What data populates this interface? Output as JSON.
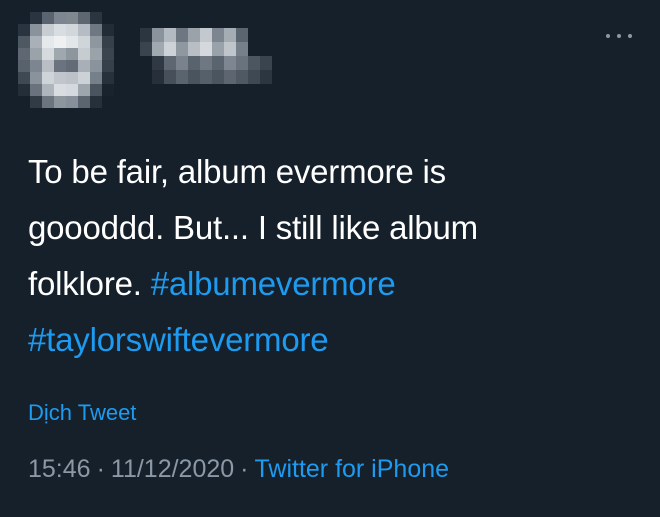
{
  "user": {
    "avatar_state": "pixelated",
    "name_state": "pixelated"
  },
  "menu": {
    "icon": "more-horizontal-icon"
  },
  "tweet": {
    "line1": "To be fair, album evermore is",
    "line2": "goooddd. But... I still like album",
    "line3_text": "folklore. ",
    "hashtag1": "#albumevermore",
    "hashtag2": "#taylorswiftevermore"
  },
  "translate_label": "Dịch Tweet",
  "meta": {
    "time": "15:46",
    "date": "11/12/2020",
    "separator": "·",
    "source": "Twitter for iPhone"
  },
  "colors": {
    "background": "#15202b",
    "text": "#ffffff",
    "accent": "#1d9bf0",
    "muted": "#8b98a5"
  }
}
